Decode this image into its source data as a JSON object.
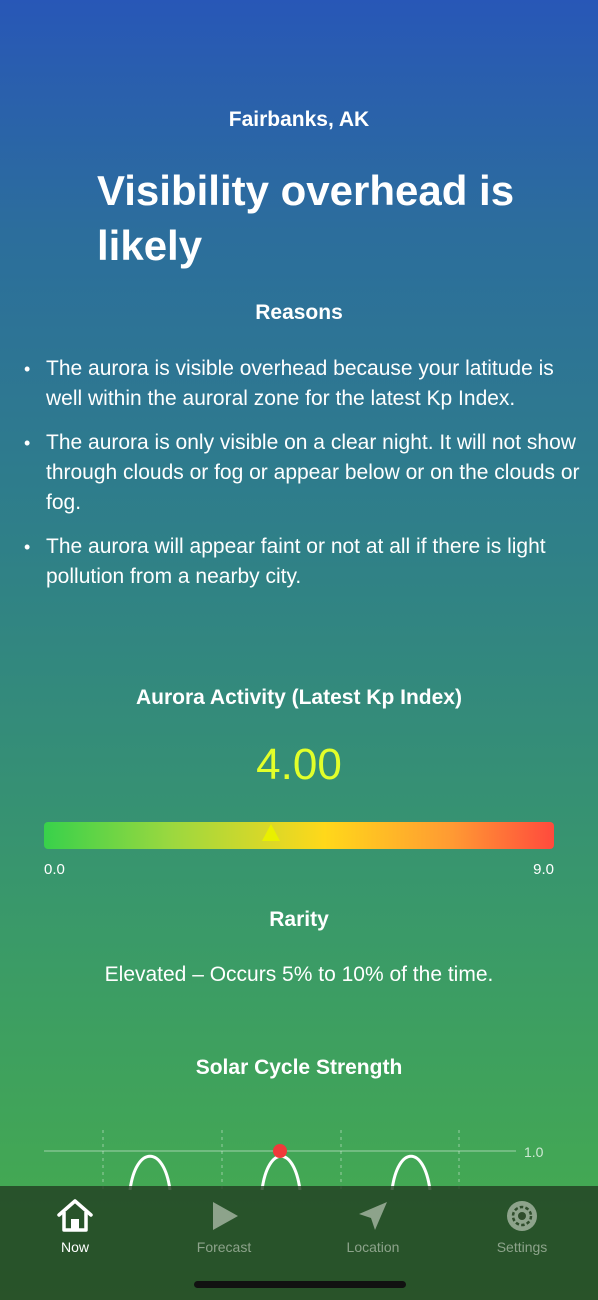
{
  "location": "Fairbanks, AK",
  "headline": "Visibility overhead is likely",
  "reasons": {
    "title": "Reasons",
    "items": [
      "The aurora is visible overhead because your latitude is well within the auroral zone for the latest Kp Index.",
      "The aurora is only visible on a clear night. It will not show through clouds or fog or appear below or on the clouds or fog.",
      "The aurora will appear faint or not at all if there is light pollution from a nearby city."
    ]
  },
  "activity": {
    "title": "Aurora Activity (Latest Kp Index)",
    "kp_value": "4.00",
    "kp_numeric": 4.0,
    "scale_min": "0.0",
    "scale_max": "9.0",
    "value_color": "#e2ff2a"
  },
  "rarity": {
    "title": "Rarity",
    "text": "Elevated – Occurs 5% to 10% of the time."
  },
  "solar_cycle": {
    "title": "Solar Cycle Strength",
    "axis_label": "1.0",
    "marker_color": "#f03a3a"
  },
  "tab_bar": {
    "tabs": [
      {
        "label": "Now",
        "icon": "house-icon",
        "active": true
      },
      {
        "label": "Forecast",
        "icon": "play-icon",
        "active": false
      },
      {
        "label": "Location",
        "icon": "location-arrow-icon",
        "active": false
      },
      {
        "label": "Settings",
        "icon": "gear-icon",
        "active": false
      }
    ]
  }
}
